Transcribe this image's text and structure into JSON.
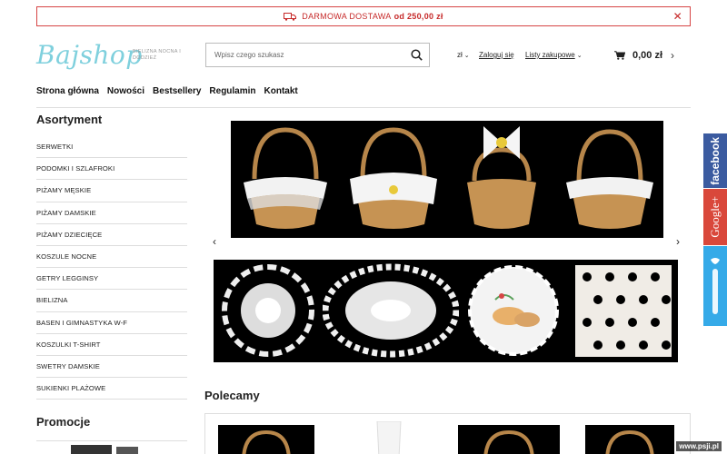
{
  "banner": {
    "text": "DARMOWA DOSTAWA",
    "amount": "od 250,00 zł",
    "close_symbol": "✕"
  },
  "header": {
    "logo": "Bajshop",
    "tagline": "BIELIZNA NOCNA I DODZIEŻ",
    "search_placeholder": "Wpisz czego szukasz",
    "currency": "zł",
    "login": "Zaloguj się",
    "lists": "Listy zakupowe",
    "cart_total": "0,00 zł"
  },
  "nav": [
    "Strona główna",
    "Nowości",
    "Bestsellery",
    "Regulamin",
    "Kontakt"
  ],
  "sidebar": {
    "title": "Asortyment",
    "categories": [
      "SERWETKI",
      "PODOMKI I SZLAFROKI",
      "PIŻAMY MĘSKIE",
      "PIŻAMY DAMSKIE",
      "PIŻAMY DZIECIĘCE",
      "KOSZULE NOCNE",
      "GETRY LEGGINSY",
      "BIELIZNA",
      "BASEN I GIMNASTYKA W-F",
      "KOSZULKI T-SHIRT",
      "SWETRY DAMSKIE",
      "SUKIENKI PLAŻOWE"
    ],
    "promo_title": "Promocje"
  },
  "main": {
    "recommended_title": "Polecamy"
  },
  "social": {
    "facebook": "facebook",
    "google": "Google+"
  },
  "watermark": "www.psji.pl",
  "colors": {
    "accent_red": "#c62828",
    "logo_blue": "#7fd0dd",
    "facebook": "#3b5ba0",
    "google": "#d9483b",
    "twitter": "#35aae8"
  },
  "icons": [
    "truck-icon",
    "close-icon",
    "search-icon",
    "cart-icon",
    "chevron-right-icon",
    "chevron-left-icon",
    "twitter-icon"
  ]
}
